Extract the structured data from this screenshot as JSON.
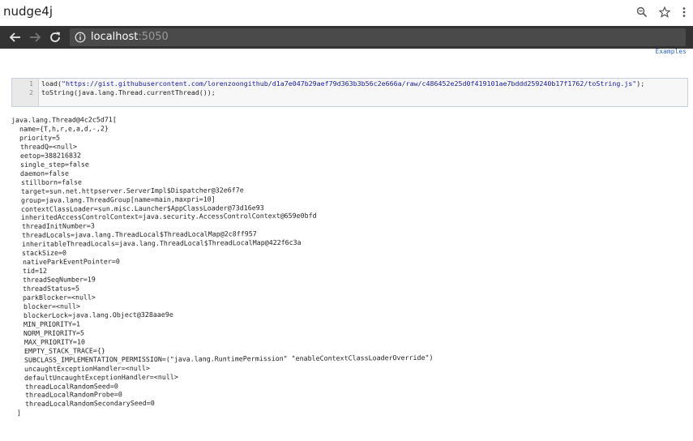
{
  "window": {
    "title": "nudge4j",
    "icons": [
      "zoom-icon",
      "star-icon",
      "menu-icon"
    ]
  },
  "browser": {
    "url_host": "localhost",
    "url_port": ":5050",
    "nav": [
      "back-icon",
      "forward-icon",
      "reload-icon",
      "info-icon"
    ]
  },
  "page": {
    "examples_link": "Examples",
    "editor": {
      "line_numbers": [
        "1",
        "2"
      ],
      "line1_prefix": "load(",
      "line1_url": "\"https://gist.githubusercontent.com/lorenzoongithub/d1a7e047b29aef79d363b3b56c2e666a/raw/c486452e25d0f419101ae7bddd259240b17f1762/toString.js\"",
      "line1_suffix": ");",
      "line2": "toString(java.lang.Thread.currentThread());"
    },
    "output_lines": [
      "java.lang.Thread@4c2c5d71[",
      "  name={T,h,r,e,a,d,-,2}",
      "  priority=5",
      "  threadQ=<null>",
      "  eetop=388216832",
      "  single_step=false",
      "  daemon=false",
      "  stillborn=false",
      "  target=sun.net.httpserver.ServerImpl$Dispatcher@32e6f7e",
      "  group=java.lang.ThreadGroup[name=main,maxpri=10]",
      "  contextClassLoader=sun.misc.Launcher$AppClassLoader@73d16e93",
      "  inheritedAccessControlContext=java.security.AccessControlContext@659e0bfd",
      "  threadInitNumber=3",
      "  threadLocals=java.lang.ThreadLocal$ThreadLocalMap@2c8ff957",
      "  inheritableThreadLocals=java.lang.ThreadLocal$ThreadLocalMap@422f6c3a",
      "  stackSize=0",
      "  nativeParkEventPointer=0",
      "  tid=12",
      "  threadSeqNumber=19",
      "  threadStatus=5",
      "  parkBlocker=<null>",
      "  blocker=<null>",
      "  blockerLock=java.lang.Object@328aae9e",
      "  MIN_PRIORITY=1",
      "  NORM_PRIORITY=5",
      "  MAX_PRIORITY=10",
      "  EMPTY_STACK_TRACE={}",
      "  SUBCLASS_IMPLEMENTATION_PERMISSION=(\"java.lang.RuntimePermission\" \"enableContextClassLoaderOverride\")",
      "  uncaughtExceptionHandler=<null>",
      "  defaultUncaughtExceptionHandler=<null>",
      "  threadLocalRandomSeed=0",
      "  threadLocalRandomProbe=0",
      "  threadLocalRandomSecondarySeed=0",
      "]"
    ]
  },
  "colors": {
    "toolbar": "#333333",
    "omnibox": "#4a4a4a",
    "link": "#3366bb",
    "string": "#1a1aa6"
  }
}
